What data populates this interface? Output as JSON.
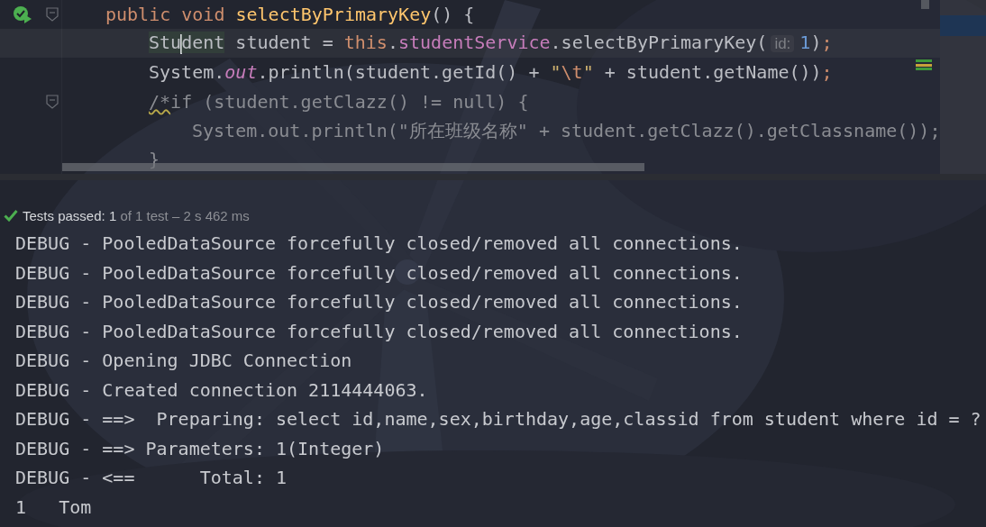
{
  "editor": {
    "lines": [
      {
        "current": false,
        "run": true,
        "fold": true,
        "tokens": [
          {
            "kind": "keyword",
            "text": "public void "
          },
          {
            "kind": "method",
            "text": "selectByPrimaryKey"
          },
          {
            "kind": "plain",
            "text": "() {"
          }
        ],
        "children": [
          {
            "current": true,
            "run": false,
            "fold": false,
            "tokens": [
              {
                "kind": "mark",
                "text": "Stu"
              },
              {
                "kind": "caret"
              },
              {
                "kind": "mark",
                "text": "dent"
              },
              {
                "kind": "plain",
                "text": " student = "
              },
              {
                "kind": "keyword",
                "text": "this"
              },
              {
                "kind": "plain",
                "text": "."
              },
              {
                "kind": "field",
                "text": "studentService"
              },
              {
                "kind": "plain",
                "text": ".selectByPrimaryKey("
              },
              {
                "kind": "hint",
                "text": "id:"
              },
              {
                "kind": "number",
                "text": "1"
              },
              {
                "kind": "plain",
                "text": ")"
              },
              {
                "kind": "keyword",
                "text": ";"
              }
            ]
          },
          {
            "current": false,
            "run": false,
            "fold": false,
            "tokens": [
              {
                "kind": "plain",
                "text": "System."
              },
              {
                "kind": "static",
                "text": "out"
              },
              {
                "kind": "plain",
                "text": ".println(student.getId() + "
              },
              {
                "kind": "string",
                "text": "\""
              },
              {
                "kind": "escape",
                "text": "\\t"
              },
              {
                "kind": "string",
                "text": "\""
              },
              {
                "kind": "plain",
                "text": " + student.getName())"
              },
              {
                "kind": "keyword",
                "text": ";"
              }
            ]
          },
          {
            "current": false,
            "run": false,
            "fold": true,
            "tokens": [
              {
                "kind": "warn",
                "text": "/*"
              },
              {
                "kind": "comment",
                "text": "if (student.getClazz() != null) {"
              }
            ],
            "children": [
              {
                "current": false,
                "run": false,
                "fold": false,
                "tokens": [
                  {
                    "kind": "comment",
                    "text": "System.out.println(\"所在班级名称\" + student.getClazz().getClassname());"
                  }
                ]
              }
            ]
          },
          {
            "current": false,
            "run": false,
            "fold": false,
            "tokens": [
              {
                "kind": "comment",
                "text": "}"
              }
            ]
          }
        ]
      }
    ]
  },
  "test_status": {
    "label": "Tests passed:",
    "count": "1",
    "detail": "of 1 test – 2 s 462 ms"
  },
  "console": [
    "DEBUG - PooledDataSource forcefully closed/removed all connections.",
    "DEBUG - PooledDataSource forcefully closed/removed all connections.",
    "DEBUG - PooledDataSource forcefully closed/removed all connections.",
    "DEBUG - PooledDataSource forcefully closed/removed all connections.",
    "DEBUG - Opening JDBC Connection",
    "DEBUG - Created connection 2114444063.",
    "DEBUG - ==>  Preparing: select id,name,sex,birthday,age,classid from student where id = ?",
    "DEBUG - ==> Parameters: 1(Integer)",
    "DEBUG - <==      Total: 1",
    "1   Tom"
  ]
}
